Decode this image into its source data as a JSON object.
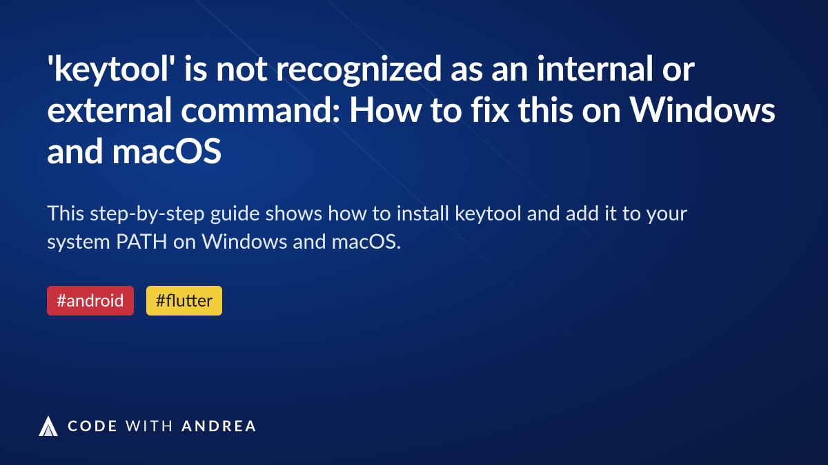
{
  "article": {
    "title": "'keytool' is not recognized as an internal or external command: How to fix this on Windows and macOS",
    "subtitle": "This step-by-step guide shows how to install keytool and add it to your system PATH on Windows and macOS.",
    "tags": [
      {
        "label": "#android",
        "style": "red"
      },
      {
        "label": "#flutter",
        "style": "yellow"
      }
    ]
  },
  "brand": {
    "word1": "CODE",
    "word2": "WITH",
    "word3": "ANDREA"
  }
}
